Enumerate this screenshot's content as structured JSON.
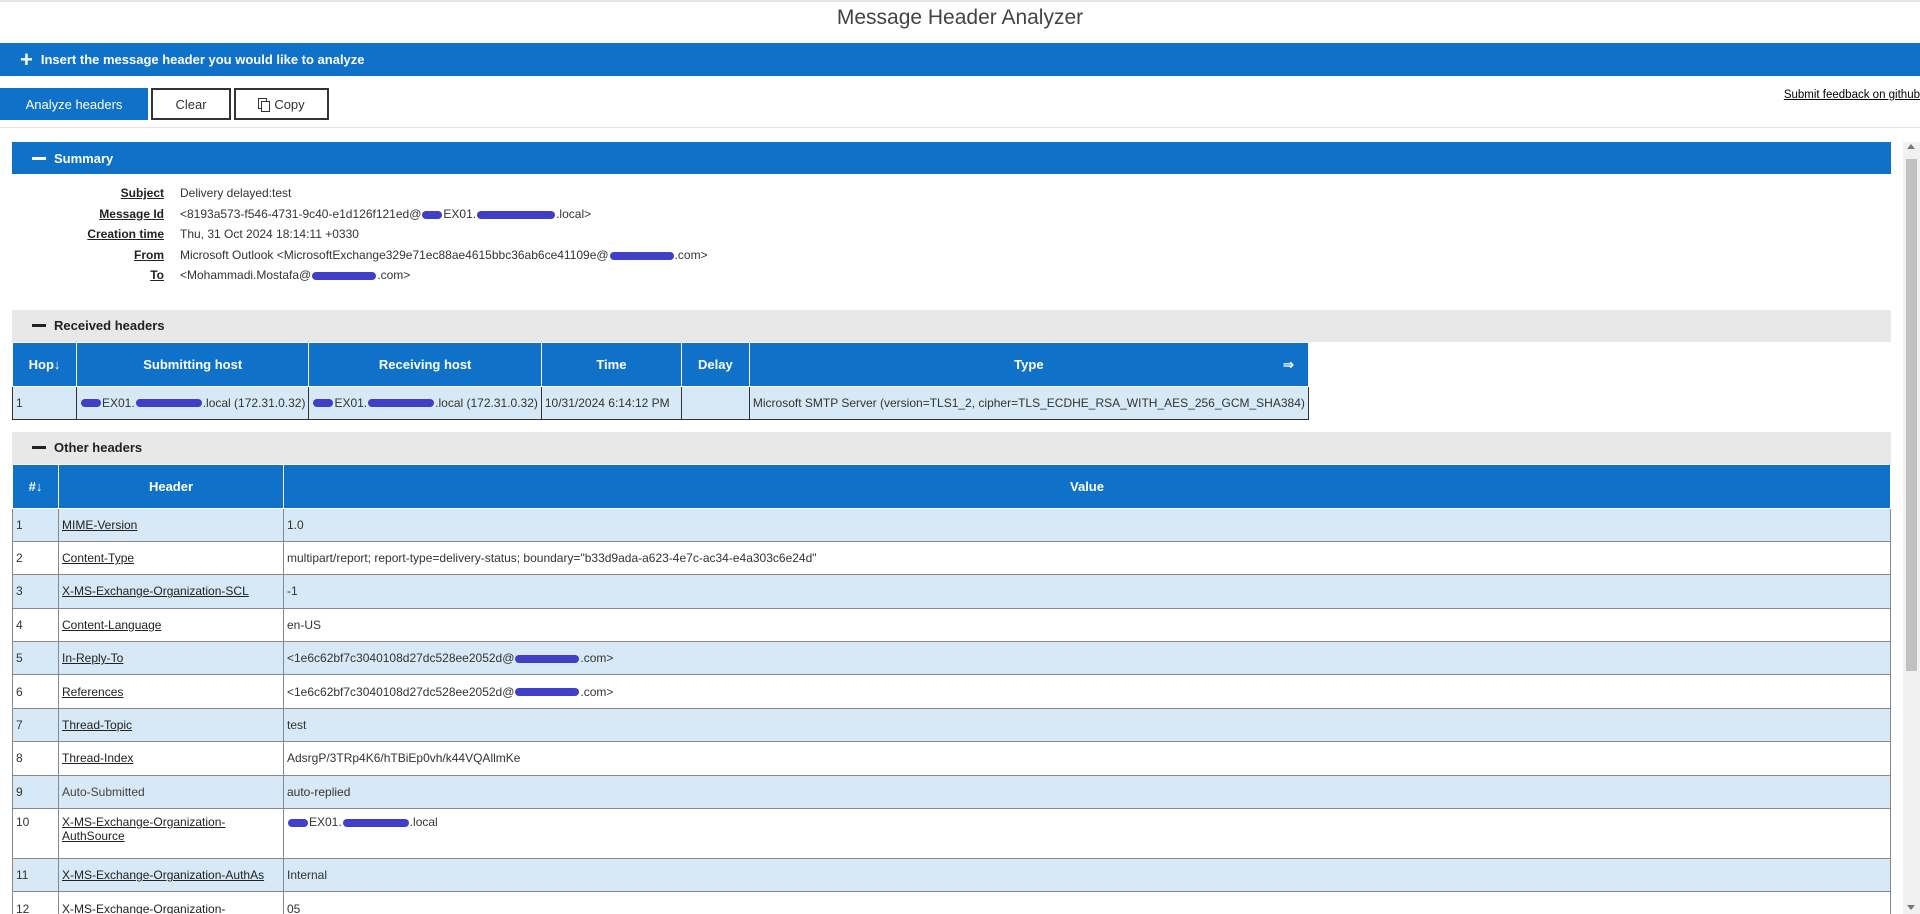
{
  "page": {
    "title": "Message Header Analyzer"
  },
  "insert_bar": {
    "label": "Insert the message header you would like to analyze"
  },
  "toolbar": {
    "analyze_label": "Analyze headers",
    "clear_label": "Clear",
    "copy_label": "Copy",
    "feedback_label": "Submit feedback on github"
  },
  "summary": {
    "title": "Summary",
    "subject_label": "Subject",
    "subject_value": "Delivery delayed:test",
    "messageid_label": "Message Id",
    "messageid_a": "<8193a573-f546-4731-9c40-e1d126f121ed@",
    "messageid_b": "EX01.",
    "messageid_c": ".local>",
    "created_label": "Creation time",
    "created_value": "Thu, 31 Oct 2024 18:14:11 +0330",
    "from_label": "From",
    "from_a": "Microsoft Outlook <MicrosoftExchange329e71ec88ae4615bbc36ab6ce41109e@",
    "from_b": ".com>",
    "to_label": "To",
    "to_a": "<Mohammadi.Mostafa@",
    "to_b": ".com>"
  },
  "received": {
    "title": "Received headers",
    "columns": {
      "hop": "Hop↓",
      "submitting": "Submitting host",
      "receiving": "Receiving host",
      "time": "Time",
      "delay": "Delay",
      "type": "Type",
      "type_arrow": "⇒"
    },
    "row": {
      "hop": "1",
      "sub_a": "EX01.",
      "sub_b": ".local (172.31.0.32)",
      "rec_a": "EX01.",
      "rec_b": ".local (172.31.0.32)",
      "time": "10/31/2024 6:14:12 PM",
      "delay": "",
      "type": "Microsoft SMTP Server (version=TLS1_2, cipher=TLS_ECDHE_RSA_WITH_AES_256_GCM_SHA384)"
    }
  },
  "other": {
    "title": "Other headers",
    "columns": {
      "num": "#↓",
      "header": "Header",
      "value": "Value"
    },
    "rows": [
      {
        "num": "1",
        "header": "MIME-Version",
        "value": "1.0"
      },
      {
        "num": "2",
        "header": "Content-Type",
        "value": "multipart/report; report-type=delivery-status; boundary=\"b33d9ada-a623-4e7c-ac34-e4a303c6e24d\""
      },
      {
        "num": "3",
        "header": "X-MS-Exchange-Organization-SCL",
        "value": "-1"
      },
      {
        "num": "4",
        "header": "Content-Language",
        "value": "en-US"
      },
      {
        "num": "5",
        "header": "In-Reply-To",
        "value_a": "<1e6c62bf7c3040108d27dc528ee2052d@",
        "value_b": ".com>"
      },
      {
        "num": "6",
        "header": "References",
        "value_a": "<1e6c62bf7c3040108d27dc528ee2052d@",
        "value_b": ".com>"
      },
      {
        "num": "7",
        "header": "Thread-Topic",
        "value": "test"
      },
      {
        "num": "8",
        "header": "Thread-Index",
        "value": "AdsrgP/3TRp4K6/hTBiEp0vh/k44VQAllmKe"
      },
      {
        "num": "9",
        "header": "Auto-Submitted",
        "value": "auto-replied"
      },
      {
        "num": "10",
        "header_a": "X-MS-Exchange-Organization-",
        "header_b": "AuthSource",
        "value_a": "EX01.",
        "value_b": ".local"
      },
      {
        "num": "11",
        "header": "X-MS-Exchange-Organization-AuthAs",
        "value": "Internal"
      },
      {
        "num": "12",
        "header": "X-MS-Exchange-Organization-",
        "value": "05"
      }
    ]
  },
  "colors": {
    "accent": "#0f72c8",
    "row_tint": "#d7e8f6",
    "redaction": "#3f3fc8"
  }
}
